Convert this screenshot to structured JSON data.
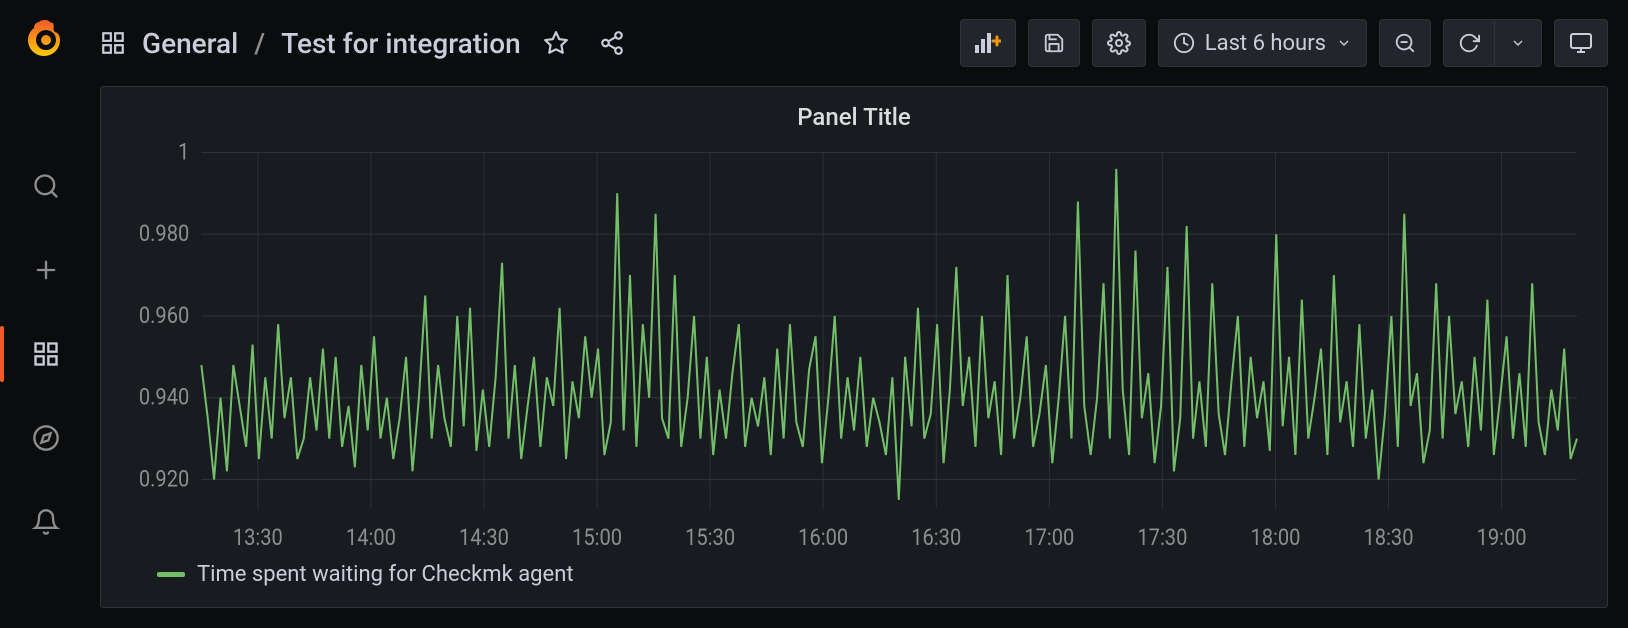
{
  "colors": {
    "accent": "#f05a28",
    "series": "#73bf69"
  },
  "sidebar": {
    "items": [
      {
        "name": "search-icon"
      },
      {
        "name": "plus-icon"
      },
      {
        "name": "dashboards-icon",
        "active": true
      },
      {
        "name": "compass-icon"
      },
      {
        "name": "bell-icon"
      }
    ]
  },
  "breadcrumb": {
    "root": "General",
    "separator": "/",
    "page": "Test for integration"
  },
  "toolbar": {
    "time_label": "Last 6 hours"
  },
  "panel": {
    "title": "Panel Title",
    "legend": "Time spent waiting for Checkmk agent"
  },
  "chart_data": {
    "type": "line",
    "title": "Panel Title",
    "xlabel": "",
    "ylabel": "",
    "ylim": [
      0.913,
      1.0
    ],
    "x_ticks": [
      "13:30",
      "14:00",
      "14:30",
      "15:00",
      "15:30",
      "16:00",
      "16:30",
      "17:00",
      "17:30",
      "18:00",
      "18:30",
      "19:00"
    ],
    "y_ticks": [
      0.92,
      0.94,
      0.96,
      0.98,
      1.0
    ],
    "series": [
      {
        "name": "Time spent waiting for Checkmk agent",
        "color": "#73bf69",
        "x_start_minutes": 795,
        "x_end_minutes": 1160,
        "values": [
          0.948,
          0.935,
          0.92,
          0.94,
          0.922,
          0.948,
          0.938,
          0.928,
          0.953,
          0.925,
          0.945,
          0.93,
          0.958,
          0.935,
          0.945,
          0.925,
          0.93,
          0.945,
          0.932,
          0.952,
          0.93,
          0.95,
          0.928,
          0.938,
          0.923,
          0.948,
          0.932,
          0.955,
          0.93,
          0.94,
          0.925,
          0.935,
          0.95,
          0.922,
          0.94,
          0.965,
          0.93,
          0.948,
          0.935,
          0.928,
          0.96,
          0.933,
          0.962,
          0.927,
          0.942,
          0.928,
          0.945,
          0.973,
          0.93,
          0.948,
          0.925,
          0.938,
          0.95,
          0.928,
          0.945,
          0.938,
          0.962,
          0.925,
          0.944,
          0.935,
          0.955,
          0.94,
          0.952,
          0.926,
          0.934,
          0.99,
          0.932,
          0.97,
          0.928,
          0.958,
          0.94,
          0.985,
          0.935,
          0.93,
          0.97,
          0.928,
          0.94,
          0.96,
          0.93,
          0.95,
          0.926,
          0.942,
          0.93,
          0.946,
          0.958,
          0.928,
          0.94,
          0.933,
          0.945,
          0.926,
          0.952,
          0.93,
          0.958,
          0.934,
          0.928,
          0.947,
          0.955,
          0.924,
          0.94,
          0.96,
          0.93,
          0.945,
          0.932,
          0.95,
          0.928,
          0.94,
          0.934,
          0.926,
          0.945,
          0.915,
          0.95,
          0.933,
          0.962,
          0.93,
          0.936,
          0.958,
          0.924,
          0.942,
          0.972,
          0.938,
          0.95,
          0.928,
          0.96,
          0.935,
          0.944,
          0.926,
          0.97,
          0.93,
          0.94,
          0.955,
          0.928,
          0.936,
          0.948,
          0.924,
          0.94,
          0.96,
          0.93,
          0.988,
          0.938,
          0.926,
          0.94,
          0.968,
          0.93,
          0.996,
          0.942,
          0.926,
          0.976,
          0.935,
          0.946,
          0.924,
          0.938,
          0.972,
          0.922,
          0.935,
          0.982,
          0.93,
          0.944,
          0.928,
          0.968,
          0.936,
          0.926,
          0.944,
          0.96,
          0.928,
          0.95,
          0.935,
          0.944,
          0.927,
          0.98,
          0.933,
          0.95,
          0.926,
          0.964,
          0.93,
          0.94,
          0.952,
          0.926,
          0.97,
          0.934,
          0.944,
          0.928,
          0.958,
          0.93,
          0.942,
          0.92,
          0.936,
          0.96,
          0.928,
          0.985,
          0.938,
          0.946,
          0.924,
          0.932,
          0.968,
          0.93,
          0.96,
          0.936,
          0.944,
          0.928,
          0.95,
          0.932,
          0.964,
          0.926,
          0.94,
          0.955,
          0.93,
          0.946,
          0.928,
          0.968,
          0.934,
          0.926,
          0.942,
          0.932,
          0.952,
          0.925,
          0.93
        ]
      }
    ]
  }
}
